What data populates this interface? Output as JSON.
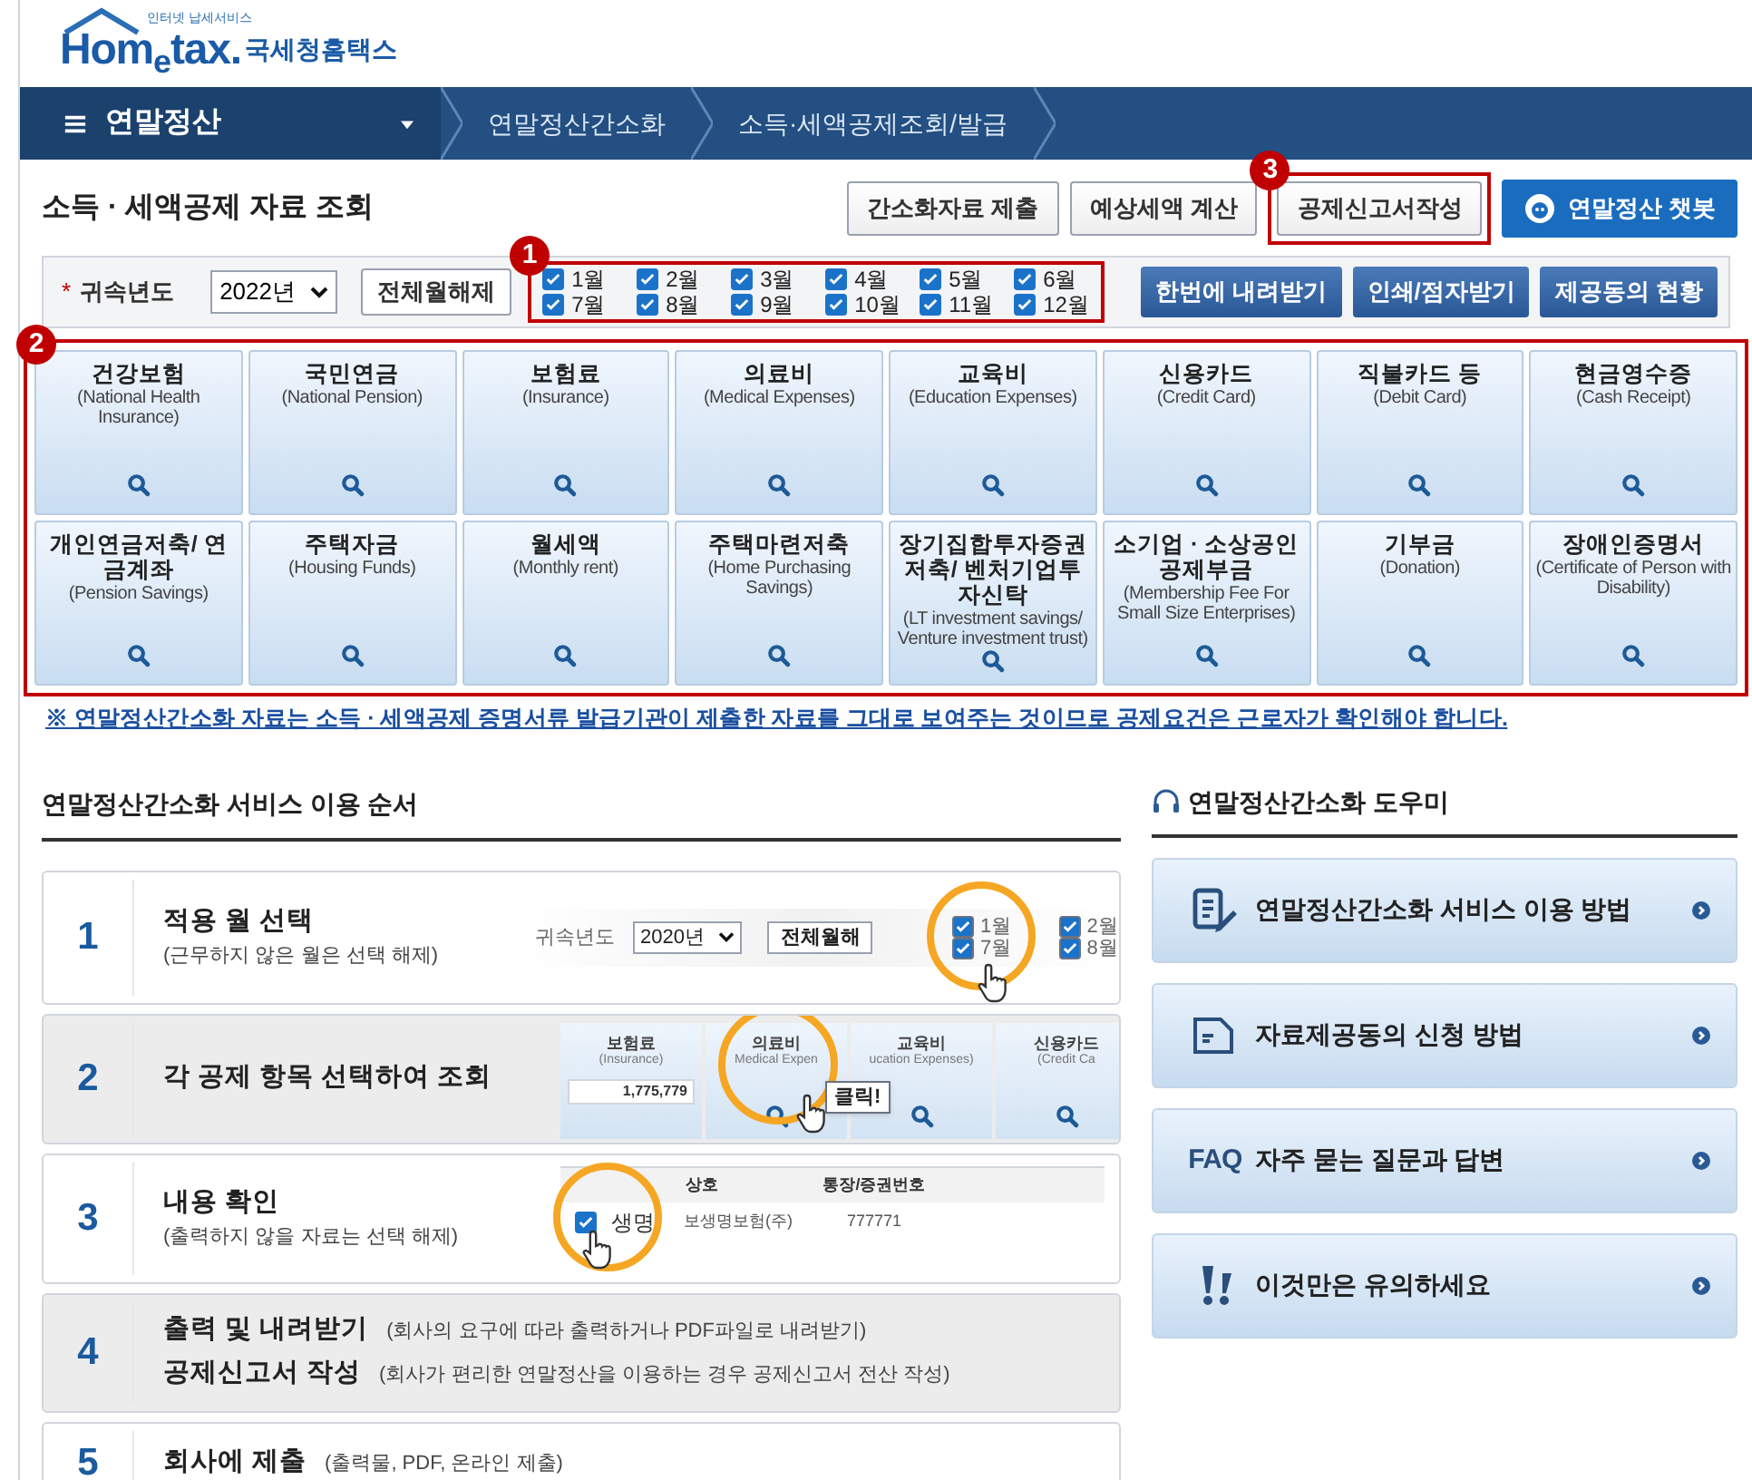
{
  "logo": {
    "tagline": "인터넷 납세서비스",
    "brand": "Hom$_{e}$tax.",
    "name": "국세청홈택스"
  },
  "nav": {
    "menu": "연말정산",
    "breadcrumbs": [
      "연말정산간소화",
      "소득·세액공제조회/발급"
    ]
  },
  "page_title": "소득 · 세액공제 자료 조회",
  "actions": [
    {
      "label": "간소화자료 제출",
      "kind": "plain"
    },
    {
      "label": "예상세액 계산",
      "kind": "plain"
    },
    {
      "label": "공제신고서작성",
      "kind": "plain",
      "marker": "3"
    },
    {
      "label": "연말정산 챗봇",
      "kind": "chatbot"
    }
  ],
  "filter": {
    "required_mark": "*",
    "label": "귀속년도",
    "year": "2022년",
    "clear_button": "전체월해제",
    "marker": "1",
    "months": [
      {
        "label": "1월",
        "checked": true
      },
      {
        "label": "2월",
        "checked": true
      },
      {
        "label": "3월",
        "checked": true
      },
      {
        "label": "4월",
        "checked": true
      },
      {
        "label": "5월",
        "checked": true
      },
      {
        "label": "6월",
        "checked": true
      },
      {
        "label": "7월",
        "checked": true
      },
      {
        "label": "8월",
        "checked": true
      },
      {
        "label": "9월",
        "checked": true
      },
      {
        "label": "10월",
        "checked": true
      },
      {
        "label": "11월",
        "checked": true
      },
      {
        "label": "12월",
        "checked": true
      }
    ],
    "buttons": [
      "한번에 내려받기",
      "인쇄/점자받기",
      "제공동의 현황"
    ]
  },
  "categories": {
    "marker": "2",
    "items": [
      {
        "title": "건강보험",
        "subtitle": "(National Health Insurance)"
      },
      {
        "title": "국민연금",
        "subtitle": "(National Pension)"
      },
      {
        "title": "보험료",
        "subtitle": "(Insurance)"
      },
      {
        "title": "의료비",
        "subtitle": "(Medical Expenses)"
      },
      {
        "title": "교육비",
        "subtitle": "(Education Expenses)"
      },
      {
        "title": "신용카드",
        "subtitle": "(Credit Card)"
      },
      {
        "title": "직불카드 등",
        "subtitle": "(Debit Card)"
      },
      {
        "title": "현금영수증",
        "subtitle": "(Cash Receipt)"
      },
      {
        "title": "개인연금저축/ 연금계좌",
        "subtitle": "(Pension Savings)"
      },
      {
        "title": "주택자금",
        "subtitle": "(Housing Funds)"
      },
      {
        "title": "월세액",
        "subtitle": "(Monthly rent)"
      },
      {
        "title": "주택마련저축",
        "subtitle": "(Home Purchasing Savings)"
      },
      {
        "title": "장기집합투자증권저축/ 벤처기업투자신탁",
        "subtitle": "(LT investment savings/ Venture investment trust)"
      },
      {
        "title": "소기업 · 소상공인 공제부금",
        "subtitle": "(Membership Fee For Small Size Enterprises)"
      },
      {
        "title": "기부금",
        "subtitle": "(Donation)"
      },
      {
        "title": "장애인증명서",
        "subtitle": "(Certificate of Person with Disability)"
      }
    ]
  },
  "notice": "※ 연말정산간소화 자료는 소득 · 세액공제 증명서류 발급기관이 제출한 자료를 그대로 보여주는 것이므로 공제요건은 근로자가 확인해야 합니다.",
  "steps_section": {
    "title": "연말정산간소화 서비스 이용 순서",
    "steps": [
      {
        "number": "1",
        "kind": "month_select",
        "shaded": false,
        "lines": [
          {
            "title": "적용 월 선택",
            "note": "(근무하지 않은 월은 선택 해제)"
          }
        ],
        "illustration": {
          "year_label": "귀속년도",
          "year": "2020년",
          "clear_button": "전체월해",
          "months": [
            {
              "label": "1월",
              "checked": true
            },
            {
              "label": "7월",
              "checked": true
            },
            {
              "label": "2월",
              "checked": true
            },
            {
              "label": "8월",
              "checked": true
            }
          ]
        }
      },
      {
        "number": "2",
        "kind": "category_pick",
        "shaded": true,
        "lines": [
          {
            "title": "각 공제 항목 선택하여 조회"
          }
        ],
        "illustration": {
          "callout": "클릭!",
          "tiles": [
            {
              "title": "보험료",
              "subtitle": "(Insurance)",
              "amount": "1,775,779"
            },
            {
              "title": "의료비",
              "subtitle": "Medical Expen"
            },
            {
              "title": "교육비",
              "subtitle": "ucation Expenses)"
            },
            {
              "title": "신용카드",
              "subtitle": "(Credit Ca"
            }
          ]
        }
      },
      {
        "number": "3",
        "kind": "content_check",
        "shaded": false,
        "lines": [
          {
            "title": "내용 확인",
            "note": "(출력하지 않을 자료는 선택 해제)"
          }
        ],
        "illustration": {
          "columns": [
            "상호",
            "통장/증권번호"
          ],
          "row": {
            "checked": true,
            "cells": [
              "생명",
              "보생명보험(주)",
              "777771"
            ]
          }
        }
      },
      {
        "number": "4",
        "kind": "plain",
        "shaded": true,
        "lines": [
          {
            "title": "출력 및 내려받기",
            "note": "(회사의 요구에 따라 출력하거나 PDF파일로 내려받기)"
          },
          {
            "title": "공제신고서 작성",
            "note": "(회사가 편리한 연말정산을 이용하는 경우 공제신고서 전산 작성)"
          }
        ]
      },
      {
        "number": "5",
        "kind": "plain",
        "shaded": false,
        "lines": [
          {
            "title": "회사에 제출",
            "note": "(출력물, PDF, 온라인 제출)"
          }
        ]
      }
    ]
  },
  "help": {
    "title": "연말정산간소화 도우미",
    "items": [
      {
        "kind": "doc",
        "label": "연말정산간소화 서비스 이용 방법"
      },
      {
        "kind": "form",
        "label": "자료제공동의 신청 방법"
      },
      {
        "kind": "faq",
        "icon_text": "FAQ",
        "label": "자주 묻는 질문과 답변"
      },
      {
        "kind": "alert",
        "label": "이것만은 유의하세요"
      }
    ]
  }
}
